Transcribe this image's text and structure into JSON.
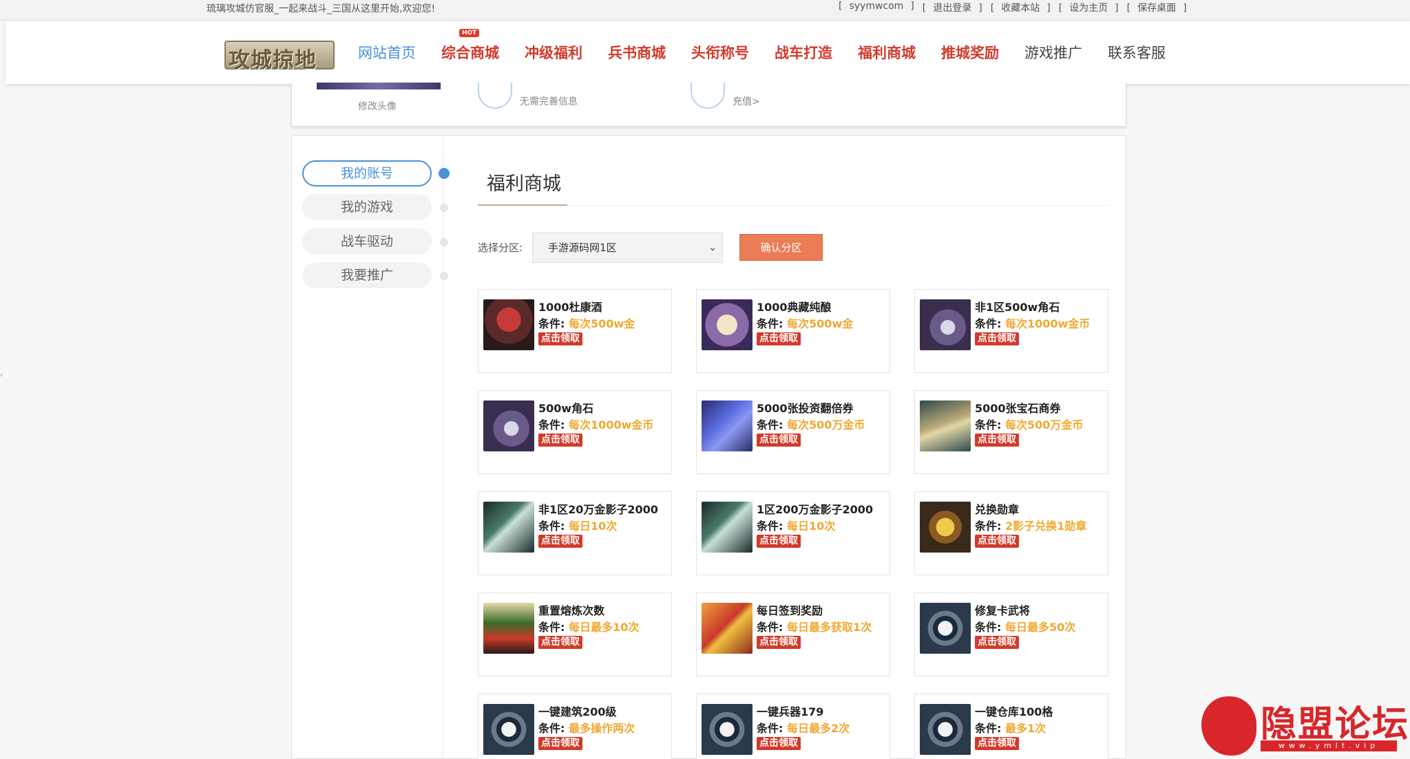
{
  "topbar": {
    "welcome": "琉璃攻城仿官服_一起来战斗_三国从这里开始,欢迎您!",
    "links": [
      {
        "label": "syymwcom"
      },
      {
        "label": "退出登录"
      },
      {
        "label": "收藏本站"
      },
      {
        "label": "设为主页"
      },
      {
        "label": "保存桌面"
      }
    ]
  },
  "header": {
    "logo_text": "攻城掠地",
    "nav": [
      {
        "label": "网站首页",
        "style": "home"
      },
      {
        "label": "综合商城",
        "style": "hot",
        "badge": "HOT"
      },
      {
        "label": "冲级福利",
        "style": "hot"
      },
      {
        "label": "兵书商城",
        "style": "hot"
      },
      {
        "label": "头衔称号",
        "style": "hot"
      },
      {
        "label": "战车打造",
        "style": "hot"
      },
      {
        "label": "福利商城",
        "style": "hot"
      },
      {
        "label": "推城奖励",
        "style": "hot"
      },
      {
        "label": "游戏推广",
        "style": "plain"
      },
      {
        "label": "联系客服",
        "style": "plain"
      }
    ]
  },
  "profile": {
    "avatar_link": "修改头像",
    "info1_sub": "无需完善信息",
    "info2_sub": "充值>"
  },
  "sidebar": {
    "items": [
      {
        "label": "我的账号",
        "active": true
      },
      {
        "label": "我的游戏",
        "active": false
      },
      {
        "label": "战车驱动",
        "active": false
      },
      {
        "label": "我要推广",
        "active": false
      }
    ]
  },
  "main": {
    "title": "福利商城",
    "zone_label": "选择分区:",
    "zone_selected": "手游源码网1区",
    "confirm_label": "确认分区",
    "condition_prefix": "条件:",
    "claim_label": "点击领取",
    "items": [
      {
        "name": "1000杜康酒",
        "condition": "每次500w金",
        "icon": "wine-icon"
      },
      {
        "name": "1000典藏纯酿",
        "condition": "每次500w金",
        "icon": "teapot-icon"
      },
      {
        "name": "非1区500w角石",
        "condition": "每次1000w金币",
        "icon": "gem-icon"
      },
      {
        "name": "500w角石",
        "condition": "每次1000w金币",
        "icon": "gem-icon"
      },
      {
        "name": "5000张投资翻倍券",
        "condition": "每次500万金币",
        "icon": "ticket-icon"
      },
      {
        "name": "5000张宝石商券",
        "condition": "每次500万金币",
        "icon": "scroll-icon"
      },
      {
        "name": "非1区20万金影子2000",
        "condition": "每日10次",
        "icon": "blade-icon"
      },
      {
        "name": "1区200万金影子2000",
        "condition": "每日10次",
        "icon": "blade-icon"
      },
      {
        "name": "兑换勋章",
        "condition": "2影子兑换1勋章",
        "icon": "medal-icon"
      },
      {
        "name": "重置熔炼次数",
        "condition": "每日最多10次",
        "icon": "general-icon"
      },
      {
        "name": "每日签到奖励",
        "condition": "每日最多获取1次",
        "icon": "gift-icon"
      },
      {
        "name": "修复卡武将",
        "condition": "每日最多50次",
        "icon": "yinyang-icon"
      },
      {
        "name": "一键建筑200级",
        "condition": "最多操作两次",
        "icon": "yinyang-icon"
      },
      {
        "name": "一键兵器179",
        "condition": "每日最多2次",
        "icon": "yinyang-icon"
      },
      {
        "name": "一键仓库100格",
        "condition": "最多1次",
        "icon": "yinyang-icon"
      }
    ]
  },
  "watermark": {
    "text": "隐盟论坛",
    "url": "www.ymlt.vip"
  },
  "colors": {
    "accent_blue": "#4a90d9",
    "nav_red": "#d23a2a",
    "condition_gold": "#f0a830",
    "confirm_orange": "#ea7c56"
  }
}
